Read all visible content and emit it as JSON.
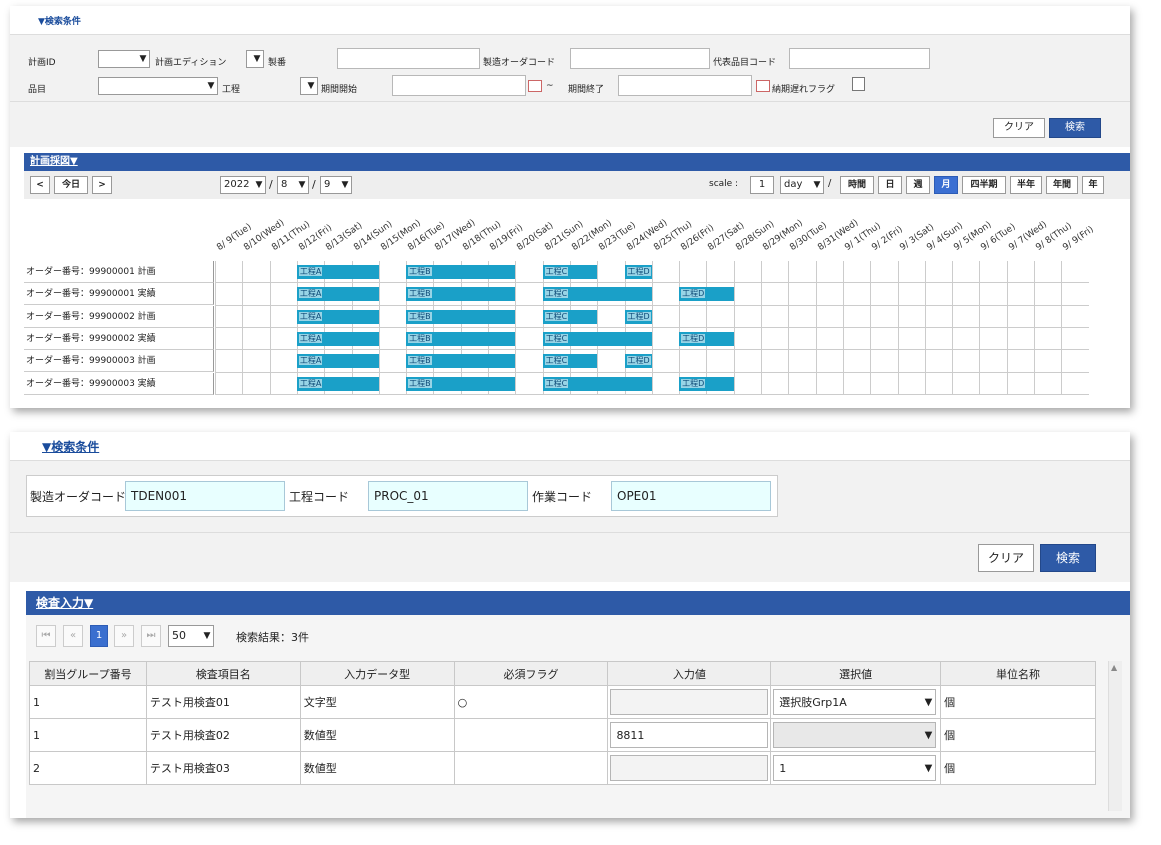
{
  "panel1": {
    "section_title": "▼検索条件",
    "conditions": {
      "row1": {
        "plan_id": "計画ID",
        "plan_edition": "計画エディション",
        "seiban": "製番",
        "mfg_order_code": "製造オーダコード",
        "rep_item_code": "代表品目コード"
      },
      "row2": {
        "item": "品目",
        "process": "工程",
        "period_start": "期間開始",
        "tilde": "~",
        "period_end": "期間終了",
        "delay_flag": "納期遅れフラグ"
      }
    },
    "buttons": {
      "clear": "クリア",
      "search": "検索"
    },
    "chart_title": "計画採図▼",
    "toolbar": {
      "prev": "<",
      "today": "今日",
      "next": ">",
      "year": "2022",
      "month": "8",
      "day": "9",
      "sep": "/",
      "scale_label": "scale :",
      "scale_value": "1",
      "scale_unit": "day",
      "units": [
        "時間",
        "日",
        "週",
        "月",
        "四半期",
        "半年",
        "年間",
        "年"
      ],
      "active_unit": "月"
    },
    "dates": [
      "8/ 9(Tue)",
      "8/10(Wed)",
      "8/11(Thu)",
      "8/12(Fri)",
      "8/13(Sat)",
      "8/14(Sun)",
      "8/15(Mon)",
      "8/16(Tue)",
      "8/17(Wed)",
      "8/18(Thu)",
      "8/19(Fri)",
      "8/20(Sat)",
      "8/21(Sun)",
      "8/22(Mon)",
      "8/23(Tue)",
      "8/24(Wed)",
      "8/25(Thu)",
      "8/26(Fri)",
      "8/27(Sat)",
      "8/28(Sun)",
      "8/29(Mon)",
      "8/30(Tue)",
      "8/31(Wed)",
      "9/ 1(Thu)",
      "9/ 2(Fri)",
      "9/ 3(Sat)",
      "9/ 4(Sun)",
      "9/ 5(Mon)",
      "9/ 6(Tue)",
      "9/ 7(Wed)",
      "9/ 8(Thu)",
      "9/ 9(Fri)"
    ],
    "rows": [
      {
        "label": "オーダー番号：99900001 計画",
        "bars": [
          {
            "name": "工程A",
            "start": 3,
            "span": 3
          },
          {
            "name": "工程B",
            "start": 7,
            "span": 4
          },
          {
            "name": "工程C",
            "start": 12,
            "span": 2
          },
          {
            "name": "工程D",
            "start": 15,
            "span": 1
          }
        ]
      },
      {
        "label": "オーダー番号：99900001 実績",
        "bars": [
          {
            "name": "工程A",
            "start": 3,
            "span": 3
          },
          {
            "name": "工程B",
            "start": 7,
            "span": 4
          },
          {
            "name": "工程C",
            "start": 12,
            "span": 4
          },
          {
            "name": "工程D",
            "start": 17,
            "span": 2
          }
        ]
      },
      {
        "label": "オーダー番号：99900002 計画",
        "bars": [
          {
            "name": "工程A",
            "start": 3,
            "span": 3
          },
          {
            "name": "工程B",
            "start": 7,
            "span": 4
          },
          {
            "name": "工程C",
            "start": 12,
            "span": 2
          },
          {
            "name": "工程D",
            "start": 15,
            "span": 1
          }
        ]
      },
      {
        "label": "オーダー番号：99900002 実績",
        "bars": [
          {
            "name": "工程A",
            "start": 3,
            "span": 3
          },
          {
            "name": "工程B",
            "start": 7,
            "span": 4
          },
          {
            "name": "工程C",
            "start": 12,
            "span": 4
          },
          {
            "name": "工程D",
            "start": 17,
            "span": 2
          }
        ]
      },
      {
        "label": "オーダー番号：99900003 計画",
        "bars": [
          {
            "name": "工程A",
            "start": 3,
            "span": 3
          },
          {
            "name": "工程B",
            "start": 7,
            "span": 4
          },
          {
            "name": "工程C",
            "start": 12,
            "span": 2
          },
          {
            "name": "工程D",
            "start": 15,
            "span": 1
          }
        ]
      },
      {
        "label": "オーダー番号：99900003 実績",
        "bars": [
          {
            "name": "工程A",
            "start": 3,
            "span": 3
          },
          {
            "name": "工程B",
            "start": 7,
            "span": 4
          },
          {
            "name": "工程C",
            "start": 12,
            "span": 4
          },
          {
            "name": "工程D",
            "start": 17,
            "span": 2
          }
        ]
      }
    ],
    "bar_color": "#1aa0c8"
  },
  "panel2": {
    "section_title": "▼検索条件",
    "fields": {
      "mfg_order_label": "製造オーダコード",
      "mfg_order_value": "TDEN001",
      "process_label": "工程コード",
      "process_value": "PROC_01",
      "work_label": "作業コード",
      "work_value": "OPE01"
    },
    "buttons": {
      "clear": "クリア",
      "search": "検索"
    },
    "grid_title": "検査入力▼",
    "pager": {
      "page": "1",
      "page_size": "50",
      "result": "検索結果：3件"
    },
    "columns": [
      "割当グループ番号",
      "検査項目名",
      "入力データ型",
      "必須フラグ",
      "入力値",
      "選択値",
      "単位名称"
    ],
    "rows": [
      {
        "group": "1",
        "name": "テスト用検査01",
        "type": "文字型",
        "required": "○",
        "input": "",
        "select": "選択肢Grp1A",
        "unit": "個"
      },
      {
        "group": "1",
        "name": "テスト用検査02",
        "type": "数値型",
        "required": "",
        "input": "8811",
        "select": "",
        "unit": "個"
      },
      {
        "group": "2",
        "name": "テスト用検査03",
        "type": "数値型",
        "required": "",
        "input": "",
        "select": "1",
        "unit": "個"
      }
    ],
    "accent_color": "#2e5aa7"
  }
}
